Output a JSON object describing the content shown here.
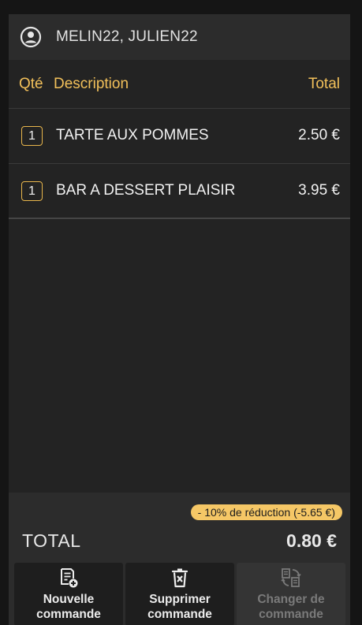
{
  "customer": {
    "name": "MELIN22, JULIEN22",
    "icon": "account-circle-icon"
  },
  "table": {
    "headers": {
      "qty": "Qté",
      "description": "Description",
      "total": "Total"
    },
    "rows": [
      {
        "qty": "1",
        "description": "TARTE AUX POMMES",
        "total": "2.50 €"
      },
      {
        "qty": "1",
        "description": "BAR A DESSERT PLAISIR",
        "total": "3.95 €"
      }
    ]
  },
  "summary": {
    "discount": "- 10% de réduction (-5.65 €)",
    "total_label": "TOTAL",
    "total_value": "0.80 €"
  },
  "actions": [
    {
      "line1": "Nouvelle",
      "line2": "commande",
      "icon": "new-order-icon",
      "enabled": true
    },
    {
      "line1": "Supprimer",
      "line2": "commande",
      "icon": "delete-order-icon",
      "enabled": true
    },
    {
      "line1": "Changer de",
      "line2": "commande",
      "icon": "switch-order-icon",
      "enabled": false
    }
  ],
  "colors": {
    "accent": "#f2c05a",
    "badge": "#f5c766",
    "background": "#232323"
  }
}
